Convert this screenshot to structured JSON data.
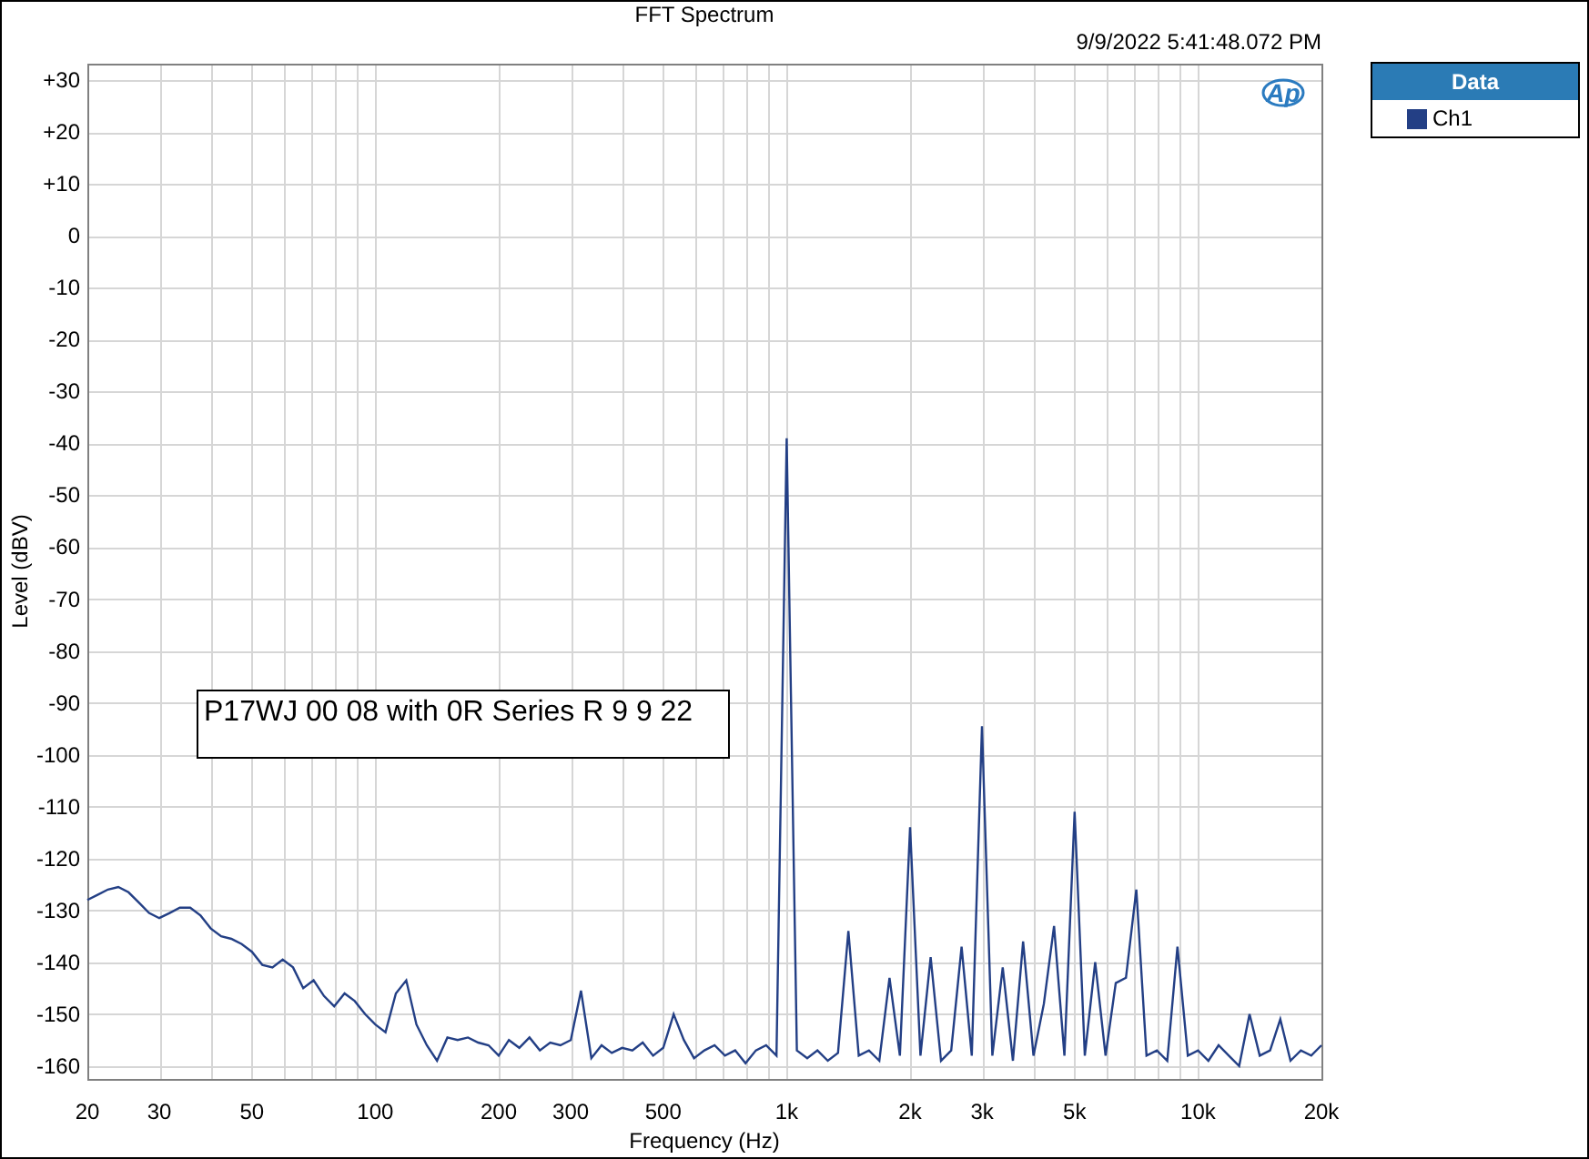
{
  "graph": {
    "logo": "Ap",
    "chart_data": {
      "type": "line",
      "title": "FFT Spectrum",
      "subtitle": "9/9/2022 5:41:48.072 PM",
      "xlabel": "Frequency (Hz)",
      "ylabel": "Level (dBV)",
      "grid": true,
      "ylim": [
        -162.5,
        33.2
      ],
      "categories": [
        "20",
        null,
        null,
        null,
        null,
        null,
        null,
        "30",
        null,
        null,
        null,
        null,
        null,
        null,
        null,
        null,
        "50",
        null,
        null,
        null,
        null,
        null,
        null,
        null,
        null,
        null,
        null,
        null,
        "100",
        null,
        null,
        null,
        null,
        null,
        null,
        null,
        null,
        null,
        null,
        null,
        "200",
        null,
        null,
        null,
        null,
        null,
        null,
        "300",
        null,
        null,
        null,
        null,
        null,
        null,
        null,
        null,
        "500",
        null,
        null,
        null,
        null,
        null,
        null,
        null,
        null,
        null,
        null,
        null,
        "1k",
        null,
        null,
        null,
        null,
        null,
        null,
        null,
        null,
        null,
        null,
        null,
        "2k",
        null,
        null,
        null,
        null,
        null,
        null,
        "3k",
        null,
        null,
        null,
        null,
        null,
        null,
        null,
        null,
        "5k",
        null,
        null,
        null,
        null,
        null,
        null,
        null,
        null,
        null,
        null,
        null,
        "10k",
        null,
        null,
        null,
        null,
        null,
        null,
        null,
        null,
        null,
        null,
        null,
        "20k"
      ],
      "yticks": [
        {
          "value": 30,
          "label": "+30"
        },
        {
          "value": 20,
          "label": "+20"
        },
        {
          "value": 10,
          "label": "+10"
        },
        0,
        -10,
        -20,
        -30,
        -40,
        -50,
        -60,
        -70,
        -80,
        -90,
        -100,
        -110,
        -120,
        -130,
        -140,
        -150,
        -160
      ],
      "series": [
        {
          "name": "Ch1",
          "color": "#233f85",
          "values": [
            -128,
            -127,
            -126,
            -125.5,
            -126.5,
            -128.5,
            -130.5,
            -131.5,
            -130.5,
            -129.5,
            -129.5,
            -131,
            -133.5,
            -135,
            -135.5,
            -136.5,
            -138,
            -140.5,
            -141,
            -139.5,
            -141,
            -145,
            -143.5,
            -146.5,
            -148.5,
            -146,
            -147.5,
            -150,
            -152,
            -153.5,
            -146,
            -143.5,
            -152,
            -156,
            -159,
            -154.5,
            -155,
            -154.5,
            -155.5,
            -156,
            -158,
            -155,
            -156.5,
            -154.5,
            -157,
            -155.5,
            -156,
            -155,
            -145.5,
            -158.5,
            -156,
            -157.5,
            -156.5,
            -157,
            -155.5,
            -158,
            -156.5,
            -150,
            -155,
            -158.5,
            -157,
            -156,
            -158,
            -157,
            -159.5,
            -157,
            -156,
            -158,
            -39,
            -157,
            -158.5,
            -157,
            -159,
            -157.5,
            -134,
            -158,
            -157,
            -159,
            -143,
            -158,
            -114,
            -158,
            -139,
            -159,
            -157,
            -137,
            -158,
            -94.5,
            -158,
            -141,
            -159,
            -136,
            -158,
            -148,
            -133,
            -158,
            -111,
            -158,
            -140,
            -158,
            -144,
            -143,
            -126,
            -158,
            -157,
            -159,
            -137,
            -158,
            -157,
            -159,
            -156,
            -158,
            -160,
            -150,
            -158,
            -157,
            -151,
            -159,
            -157,
            -158,
            -156
          ]
        }
      ],
      "annotations": [
        "P17WJ 00 08 with 0R Series R 9 9 22"
      ]
    }
  },
  "legend": {
    "title": "Data"
  }
}
